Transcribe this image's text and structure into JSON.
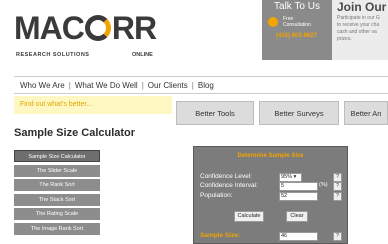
{
  "header": {
    "logo_text_a": "MAC",
    "logo_text_b": "RR",
    "logo_sub_left": "RESEARCH SOLUTIONS",
    "logo_sub_right": "ONLINE",
    "talk": {
      "title": "Talk To Us",
      "line1": "Free",
      "line2": "Consultation",
      "phone": "(416) 602-8627"
    },
    "join": {
      "title": "Join Our",
      "lines": [
        "Participate in our G",
        "to receive your cha",
        "cash and other va",
        "prizes."
      ]
    }
  },
  "nav": {
    "items": [
      "Who We Are",
      "What We Do Well",
      "Our Clients",
      "Blog"
    ]
  },
  "promo": {
    "text": "Find out what's better..."
  },
  "tabs": [
    "Better Tools",
    "Better Surveys",
    "Better An"
  ],
  "page_title": "Sample Size Calculator",
  "sidebar": {
    "items": [
      "Sample Size Calculator",
      "The Slider Scale",
      "The Rank Sort",
      "The Stack Sort",
      "The Rating Scale",
      "The Image Rank Sort"
    ]
  },
  "calculator": {
    "title": "Determine Sample Size",
    "confidence_level_label": "Confidence Level:",
    "confidence_level_value": "95% ▾",
    "confidence_interval_label": "Confidence Interval:",
    "confidence_interval_value": "5",
    "confidence_interval_unit": "(%)",
    "population_label": "Population:",
    "population_value": "52",
    "help_label": "?",
    "calculate_label": "Calculate",
    "clear_label": "Clear",
    "sample_size_label": "Sample Size:",
    "sample_size_value": "46"
  }
}
